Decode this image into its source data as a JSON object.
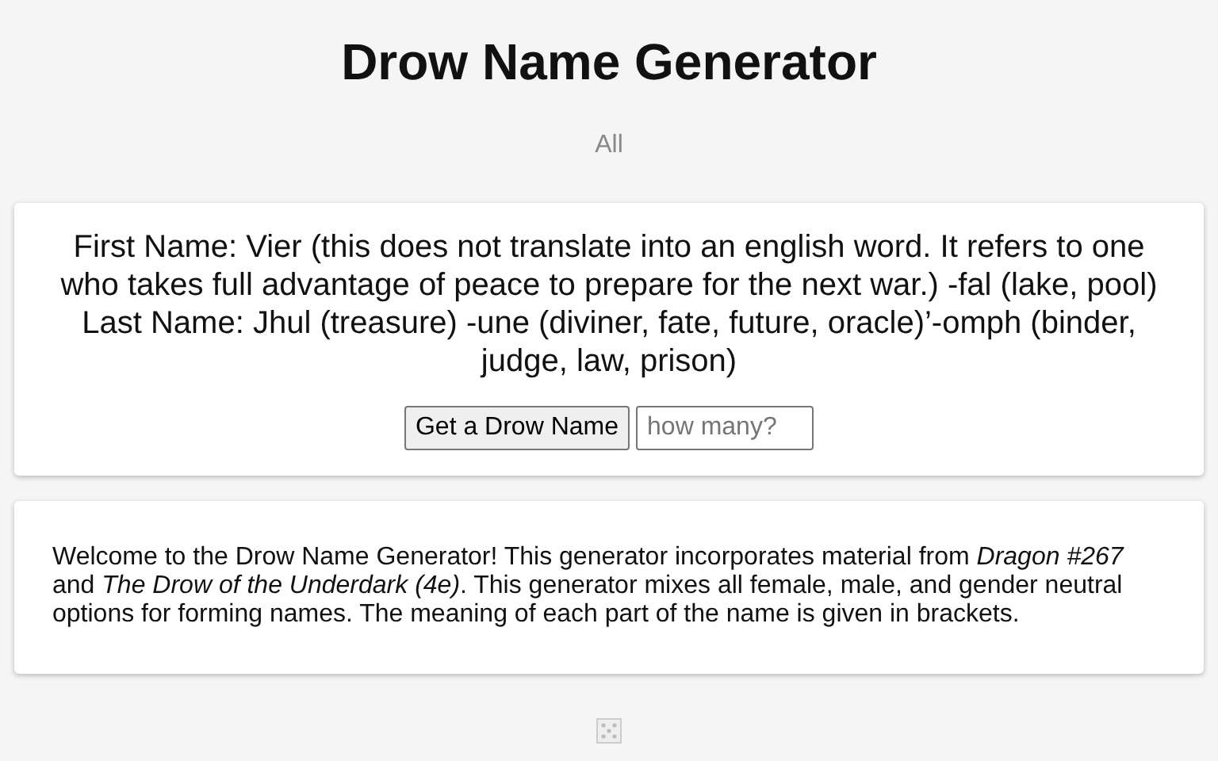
{
  "title": "Drow Name Generator",
  "filter": "All",
  "result": "First Name: Vier (this does not translate into an english word. It refers to one who takes full advantage of peace to prepare for the next war.) -fal (lake, pool) Last Name: Jhul (treasure) -une (diviner, fate, future, oracle)’-omph (binder, judge, law, prison)",
  "button": "Get a Drow Name",
  "count_field": {
    "placeholder": "how many?"
  },
  "description": "Welcome to the Drow Name Generator! This generator incorporates material from *Dragon #267* and *The Drow of the Underdark (4e)*. This generator mixes all female, male, and gender neutral options for forming names. The meaning of each part of the name is given in brackets."
}
